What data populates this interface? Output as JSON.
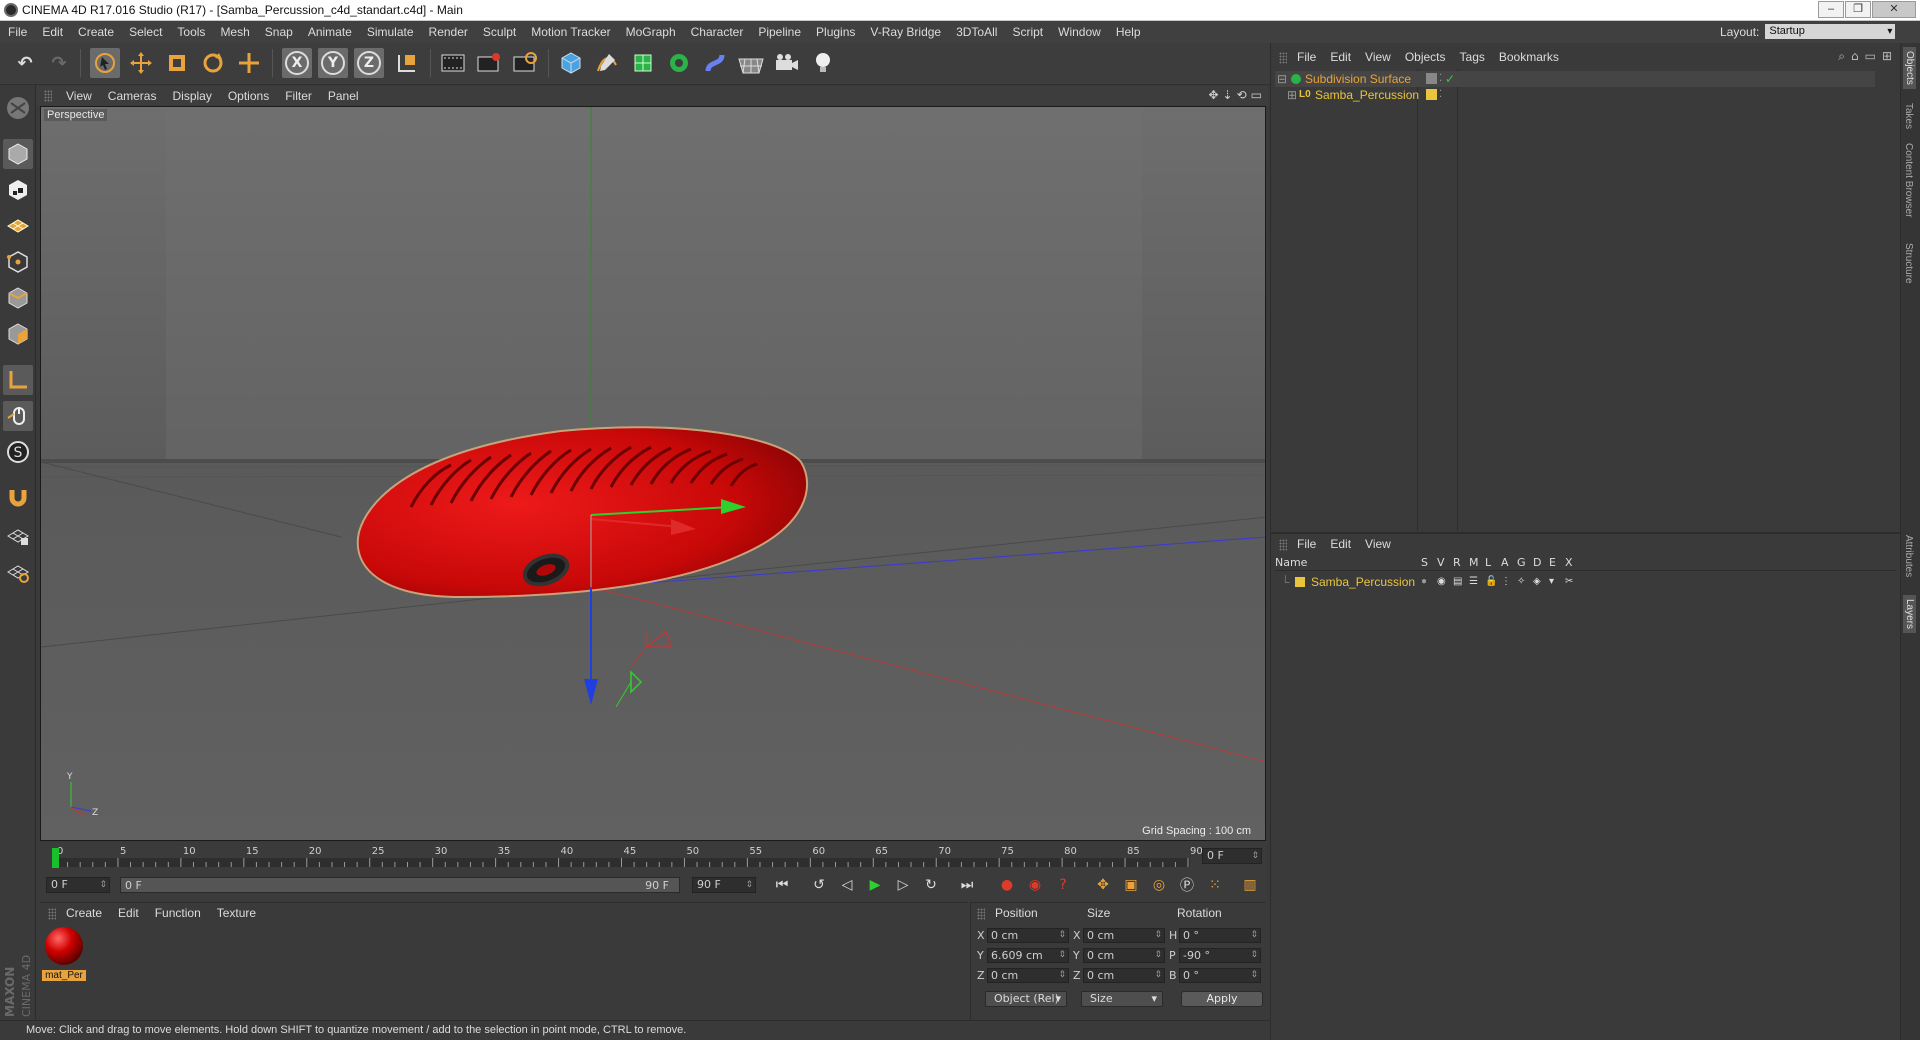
{
  "window": {
    "title": "CINEMA 4D R17.016 Studio (R17) - [Samba_Percussion_c4d_standart.c4d] - Main"
  },
  "menubar": {
    "items": [
      "File",
      "Edit",
      "Create",
      "Select",
      "Tools",
      "Mesh",
      "Snap",
      "Animate",
      "Simulate",
      "Render",
      "Sculpt",
      "Motion Tracker",
      "MoGraph",
      "Character",
      "Pipeline",
      "Plugins",
      "V-Ray Bridge",
      "3DToAll",
      "Script",
      "Window",
      "Help"
    ],
    "layout_label": "Layout:",
    "layout_value": "Startup"
  },
  "toolbar": {
    "icons": [
      "undo-icon",
      "redo-icon",
      "live-selection-icon",
      "move-icon",
      "scale-icon",
      "rotate-icon",
      "last-tool-icon",
      "x-axis-icon",
      "y-axis-icon",
      "z-axis-icon",
      "coordinate-system-icon",
      "render-view-icon",
      "render-picture-viewer-icon",
      "edit-render-settings-icon",
      "cube-icon",
      "pen-spline-icon",
      "subdivision-surface-icon",
      "cloner-icon",
      "deformer-icon",
      "floor-icon",
      "camera-icon",
      "light-icon"
    ],
    "axis_x": "X",
    "axis_y": "Y",
    "axis_z": "Z"
  },
  "viewport": {
    "menus": [
      "View",
      "Cameras",
      "Display",
      "Options",
      "Filter",
      "Panel"
    ],
    "camera_label": "Perspective",
    "grid_spacing": "Grid Spacing : 100 cm",
    "axis_y": "Y",
    "axis_z": "Z"
  },
  "timeline": {
    "ticks": [
      "0",
      "5",
      "10",
      "15",
      "20",
      "25",
      "30",
      "35",
      "40",
      "45",
      "50",
      "55",
      "60",
      "65",
      "70",
      "75",
      "80",
      "85",
      "90"
    ],
    "frame_end_field": "0 F",
    "start_field": "0 F",
    "range_start": "0 F",
    "range_end": "90 F",
    "end_field": "90 F"
  },
  "material_manager": {
    "menus": [
      "Create",
      "Edit",
      "Function",
      "Texture"
    ],
    "material_name": "mat_Per",
    "material_color": "#d00000"
  },
  "coordinates": {
    "headers": [
      "Position",
      "Size",
      "Rotation"
    ],
    "rows": [
      {
        "axis": "X",
        "position": "0 cm",
        "size_axis": "X",
        "size": "0 cm",
        "rot_axis": "H",
        "rotation": "0 °"
      },
      {
        "axis": "Y",
        "position": "6.609 cm",
        "size_axis": "Y",
        "size": "0 cm",
        "rot_axis": "P",
        "rotation": "-90 °"
      },
      {
        "axis": "Z",
        "position": "0 cm",
        "size_axis": "Z",
        "size": "0 cm",
        "rot_axis": "B",
        "rotation": "0 °"
      }
    ],
    "mode_dropdown": "Object (Rel)",
    "size_dropdown": "Size",
    "apply_label": "Apply"
  },
  "status": {
    "text": "Move: Click and drag to move elements. Hold down SHIFT to quantize movement / add to the selection in point mode, CTRL to remove."
  },
  "branding": {
    "maxon": "MAXON",
    "cinema": "CINEMA 4D"
  },
  "object_manager": {
    "menus": [
      "File",
      "Edit",
      "View",
      "Objects",
      "Tags",
      "Bookmarks"
    ],
    "objects": [
      {
        "name": "Subdivision Surface",
        "color": "#e8a33c"
      },
      {
        "name": "Samba_Percussion",
        "color": "#e8c53c"
      }
    ]
  },
  "layer_manager": {
    "menus": [
      "File",
      "Edit",
      "View"
    ],
    "columns": [
      "Name",
      "S",
      "V",
      "R",
      "M",
      "L",
      "A",
      "G",
      "D",
      "E",
      "X"
    ],
    "layers": [
      {
        "name": "Samba_Percussion",
        "color": "#e8c53c"
      }
    ]
  },
  "right_tabs": [
    "Objects",
    "Takes",
    "Content Browser",
    "Structure",
    "Attributes",
    "Layers"
  ],
  "colors": {
    "accent_orange": "#e8a33c",
    "object_red": "#d40b0b",
    "playhead_green": "#19c02b"
  }
}
